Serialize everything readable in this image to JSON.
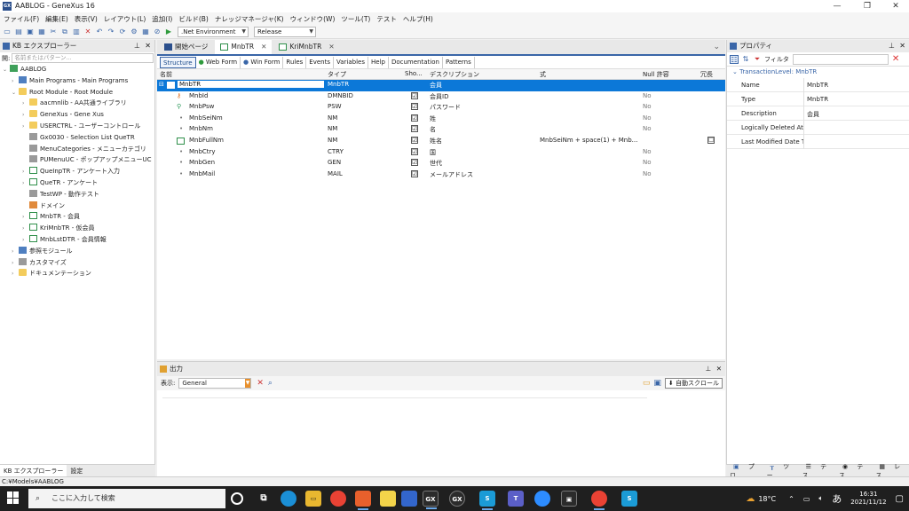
{
  "window": {
    "title": "AABLOG - GeneXus 16",
    "logo": "GX"
  },
  "menu": [
    "ファイル(F)",
    "編集(E)",
    "表示(V)",
    "レイアウト(L)",
    "追加(I)",
    "ビルド(B)",
    "ナレッジマネージャ(K)",
    "ウィンドウ(W)",
    "ツール(T)",
    "テスト",
    "ヘルプ(H)"
  ],
  "toolbar": {
    "environment": ".Net Environment",
    "configuration": "Release"
  },
  "kb_explorer": {
    "title": "KB エクスプローラー",
    "filter_label": "開:",
    "filter_placeholder": "名前またはパターン...",
    "items": [
      {
        "label": "AABLOG",
        "level": 0,
        "icon": "kb-icon",
        "exp": "⌄"
      },
      {
        "label": "Main Programs - Main Programs",
        "level": 1,
        "icon": "folder-icon",
        "exp": "›"
      },
      {
        "label": "Root Module - Root Module",
        "level": 1,
        "icon": "folder-icon",
        "exp": "⌄"
      },
      {
        "label": "aacmnlib - AA共通ライブラリ",
        "level": 2,
        "icon": "folder-icon",
        "exp": "›"
      },
      {
        "label": "GeneXus - Gene Xus",
        "level": 2,
        "icon": "folder-icon",
        "exp": "›"
      },
      {
        "label": "USERCTRL - ユーザーコントロール",
        "level": 2,
        "icon": "folder-icon",
        "exp": "›"
      },
      {
        "label": "Gx0030 - Selection List QueTR",
        "level": 2,
        "icon": "webpanel-icon",
        "exp": ""
      },
      {
        "label": "MenuCategories - メニューカテゴリ",
        "level": 2,
        "icon": "menu-icon",
        "exp": ""
      },
      {
        "label": "PUMenuUC - ポップアップメニューUC",
        "level": 2,
        "icon": "uc-icon",
        "exp": ""
      },
      {
        "label": "QueInpTR - アンケート入力",
        "level": 2,
        "icon": "transaction-icon",
        "exp": "›"
      },
      {
        "label": "QueTR - アンケート",
        "level": 2,
        "icon": "transaction-icon",
        "exp": "›"
      },
      {
        "label": "TestWP - 動作テスト",
        "level": 2,
        "icon": "webpanel-icon",
        "exp": ""
      },
      {
        "label": "ドメイン",
        "level": 2,
        "icon": "domain-icon",
        "exp": ""
      },
      {
        "label": "MnbTR - 会員",
        "level": 2,
        "icon": "transaction-icon",
        "exp": "›"
      },
      {
        "label": "KriMnbTR - 仮会員",
        "level": 2,
        "icon": "transaction-icon",
        "exp": "›"
      },
      {
        "label": "MnbLstDTR - 会員情報",
        "level": 2,
        "icon": "transaction-icon",
        "exp": "›"
      },
      {
        "label": "参照モジュール",
        "level": 1,
        "icon": "reference-icon",
        "exp": "›"
      },
      {
        "label": "カスタマイズ",
        "level": 1,
        "icon": "customize-icon",
        "exp": "›"
      },
      {
        "label": "ドキュメンテーション",
        "level": 1,
        "icon": "folder-icon",
        "exp": "›"
      }
    ],
    "bottom_tabs": [
      "KB エクスプローラー",
      "設定"
    ]
  },
  "editor": {
    "tabs": [
      {
        "label": "開始ページ",
        "icon": "gx-icon"
      },
      {
        "label": "MnbTR",
        "icon": "transaction-icon"
      },
      {
        "label": "KriMnbTR",
        "icon": "transaction-icon"
      }
    ],
    "active_tab": 1,
    "subtabs": [
      "Structure",
      "Web Form",
      "Win Form",
      "Rules",
      "Events",
      "Variables",
      "Help",
      "Documentation",
      "Patterns"
    ],
    "columns": [
      "名前",
      "タイプ",
      "Sho...",
      "デスクリプション",
      "式",
      "Null 許容",
      "冗長"
    ],
    "rows": [
      {
        "name": "MnbTR",
        "type": "MnbTR",
        "show": "",
        "desc": "会員",
        "formula": "",
        "nullable": "",
        "redundant": "",
        "selected": true,
        "icon": "level-icon"
      },
      {
        "name": "MnbId",
        "type": "DMNBID",
        "show": "☑",
        "desc": "会員ID",
        "formula": "",
        "nullable": "No",
        "redundant": "",
        "icon": "key-icon"
      },
      {
        "name": "MnbPsw",
        "type": "PSW",
        "show": "☑",
        "desc": "パスワード",
        "formula": "",
        "nullable": "No",
        "redundant": "",
        "icon": "candidate-key-icon"
      },
      {
        "name": "MnbSeiNm",
        "type": "NM",
        "show": "☑",
        "desc": "姓",
        "formula": "",
        "nullable": "No",
        "redundant": "",
        "icon": "attribute-icon"
      },
      {
        "name": "MnbNm",
        "type": "NM",
        "show": "☑",
        "desc": "名",
        "formula": "",
        "nullable": "No",
        "redundant": "",
        "icon": "attribute-icon"
      },
      {
        "name": "MnbFullNm",
        "type": "NM",
        "show": "☑",
        "desc": "姓名",
        "formula": "MnbSeiNm + space(1) + Mnb...",
        "nullable": "",
        "redundant": "☐",
        "icon": "formula-icon"
      },
      {
        "name": "MnbCtry",
        "type": "CTRY",
        "show": "☑",
        "desc": "国",
        "formula": "",
        "nullable": "No",
        "redundant": "",
        "icon": "attribute-icon"
      },
      {
        "name": "MnbGen",
        "type": "GEN",
        "show": "☑",
        "desc": "世代",
        "formula": "",
        "nullable": "No",
        "redundant": "",
        "icon": "attribute-icon"
      },
      {
        "name": "MnbMail",
        "type": "MAIL",
        "show": "☑",
        "desc": "メールアドレス",
        "formula": "",
        "nullable": "No",
        "redundant": "",
        "icon": "attribute-icon"
      }
    ]
  },
  "output": {
    "title": "出力",
    "show_label": "表示:",
    "show_value": "General",
    "autoscroll": "自動スクロール"
  },
  "properties": {
    "title": "プロパティ",
    "filter": "フィルタ",
    "category": "TransactionLevel: MnbTR",
    "rows": [
      {
        "name": "Name",
        "value": "MnbTR"
      },
      {
        "name": "Type",
        "value": "MnbTR"
      },
      {
        "name": "Description",
        "value": "会員"
      },
      {
        "name": "Logically Deleted Att",
        "value": ""
      },
      {
        "name": "Last Modified Date T",
        "value": ""
      }
    ],
    "bottom_tabs": [
      "プロ...",
      "ツー...",
      "テス...",
      "テス...",
      "レス..."
    ]
  },
  "status": {
    "path": "C:¥Models¥AABLOG"
  },
  "taskbar": {
    "search_placeholder": "ここに入力して検索",
    "temperature": "18°C",
    "ime": "あ",
    "time": "16:31",
    "date": "2021/11/12"
  },
  "colors": {
    "accent": "#3a66a8",
    "selection": "#0c78d8",
    "taskbar": "#1f1f1f"
  }
}
